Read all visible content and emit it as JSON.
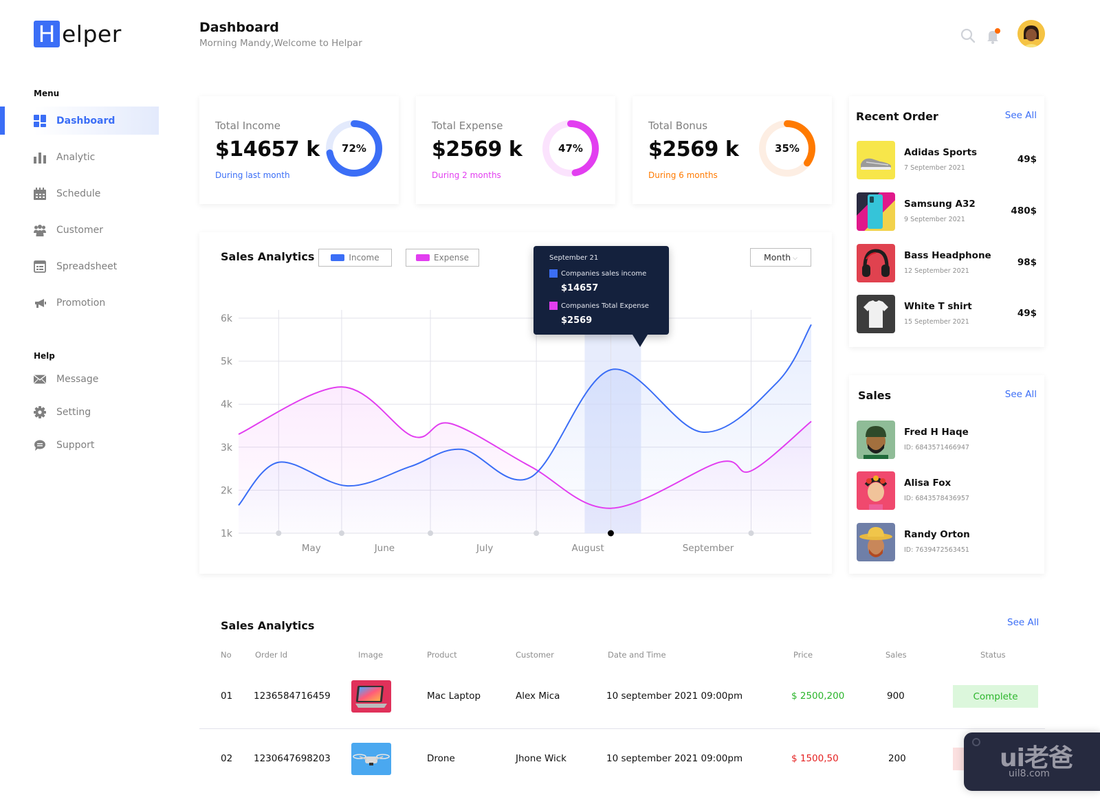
{
  "app": {
    "logo_letter": "H",
    "logo_rest": "elper"
  },
  "header": {
    "title": "Dashboard",
    "subtitle": "Morning Mandy,Welcome to Helpar",
    "icons": [
      "search-icon",
      "bell-icon",
      "user-avatar"
    ],
    "notification_dot_color": "#ff6b00"
  },
  "sidebar": {
    "menu_heading": "Menu",
    "menu_items": [
      {
        "label": "Dashboard",
        "icon": "dashboard-grid-icon",
        "active": true
      },
      {
        "label": "Analytic",
        "icon": "bar-chart-icon",
        "active": false
      },
      {
        "label": "Schedule",
        "icon": "calendar-icon",
        "active": false
      },
      {
        "label": "Customer",
        "icon": "users-icon",
        "active": false
      },
      {
        "label": "Spreadsheet",
        "icon": "spreadsheet-icon",
        "active": false
      },
      {
        "label": "Promotion",
        "icon": "megaphone-icon",
        "active": false
      }
    ],
    "help_heading": "Help",
    "help_items": [
      {
        "label": "Message",
        "icon": "envelope-icon"
      },
      {
        "label": "Setting",
        "icon": "gear-icon"
      },
      {
        "label": "Support",
        "icon": "chat-bubble-icon"
      }
    ]
  },
  "stats": [
    {
      "label": "Total Income",
      "value": "$14657 k",
      "note": "During last month",
      "percent_label": "72%",
      "percent": 72,
      "color": "#3b6ef6",
      "track": "#e3eafc"
    },
    {
      "label": "Total Expense",
      "value": "$2569 k",
      "note": "During 2 months",
      "percent_label": "47%",
      "percent": 47,
      "color": "#e23ef0",
      "track": "#fbe3fd"
    },
    {
      "label": "Total Bonus",
      "value": "$2569 k",
      "note": "During 6 months",
      "percent_label": "35%",
      "percent": 35,
      "color": "#ff7a00",
      "track": "#fdeee3"
    }
  ],
  "sales_chart": {
    "title": "Sales Analytics",
    "legend": [
      {
        "label": "Income",
        "color": "#3b6ef6"
      },
      {
        "label": "Expense",
        "color": "#e23ef0"
      }
    ],
    "period_select": "Month",
    "period_chevron": "⌵",
    "tooltip": {
      "date": "September 21",
      "income_label": "Companies sales income",
      "income_value": "$14657",
      "expense_label": "Companies Total Expense",
      "expense_value": "$2569"
    }
  },
  "chart_data": {
    "type": "area",
    "title": "Sales Analytics",
    "xlabel": "",
    "ylabel": "",
    "y_ticks": [
      "6k",
      "5k",
      "4k",
      "3k",
      "2k",
      "1k"
    ],
    "ylim": [
      1000,
      6000
    ],
    "x_labels": [
      "May",
      "June",
      "July",
      "August",
      "September"
    ],
    "x_range": [
      0,
      10
    ],
    "grid": true,
    "legend_position": "top-left",
    "highlight_x": 6.5,
    "x_markers": [
      0.7,
      1.8,
      3.35,
      5.2,
      6.5,
      8.95
    ],
    "series": [
      {
        "name": "Income",
        "color": "#3b6ef6",
        "points": [
          [
            0,
            1650
          ],
          [
            0.7,
            2650
          ],
          [
            1.9,
            2100
          ],
          [
            3.0,
            2550
          ],
          [
            3.9,
            2950
          ],
          [
            5.1,
            2300
          ],
          [
            6.5,
            4800
          ],
          [
            8.1,
            3350
          ],
          [
            9.4,
            4500
          ],
          [
            10,
            5850
          ]
        ]
      },
      {
        "name": "Expense",
        "color": "#e23ef0",
        "points": [
          [
            0,
            3300
          ],
          [
            1.8,
            4400
          ],
          [
            3.05,
            3250
          ],
          [
            3.7,
            3550
          ],
          [
            5.1,
            2550
          ],
          [
            6.5,
            1580
          ],
          [
            8.4,
            2650
          ],
          [
            8.95,
            2450
          ],
          [
            10,
            3600
          ]
        ]
      }
    ]
  },
  "recent_orders": {
    "title": "Recent Order",
    "see_all": "See All",
    "items": [
      {
        "name": "Adidas Sports",
        "date": "7 September 2021",
        "price": "49$",
        "thumb": "sneaker-image"
      },
      {
        "name": "Samsung A32",
        "date": "9 September 2021",
        "price": "480$",
        "thumb": "phone-image"
      },
      {
        "name": "Bass Headphone",
        "date": "12 September 2021",
        "price": "98$",
        "thumb": "headphone-image"
      },
      {
        "name": "White T shirt",
        "date": "15 September 2021",
        "price": "49$",
        "thumb": "tshirt-image"
      }
    ]
  },
  "sales_people": {
    "title": "Sales",
    "see_all": "See All",
    "items": [
      {
        "name": "Fred H Haqe",
        "id": "ID: 6843571466947",
        "thumb": "avatar-fred"
      },
      {
        "name": "Alisa Fox",
        "id": "ID: 6843578436957",
        "thumb": "avatar-alisa"
      },
      {
        "name": "Randy Orton",
        "id": "ID: 7639472563451",
        "thumb": "avatar-randy"
      }
    ]
  },
  "sales_table": {
    "title": "Sales Analytics",
    "see_all": "See All",
    "columns": [
      "No",
      "Order Id",
      "Image",
      "Product",
      "Customer",
      "Date and Time",
      "Price",
      "Sales",
      "Status"
    ],
    "rows": [
      {
        "no": "01",
        "order_id": "1236584716459",
        "image": "laptop-image",
        "product": "Mac Laptop",
        "customer": "Alex Mica",
        "datetime": "10 september 2021 09:00pm",
        "price": "$ 2500,200",
        "price_color": "#2bb52b",
        "sales": "900",
        "status": "Complete",
        "status_bg": "#dcf7dc",
        "status_color": "#2bb52b"
      },
      {
        "no": "02",
        "order_id": "1230647698203",
        "image": "drone-image",
        "product": "Drone",
        "customer": "Jhone Wick",
        "datetime": "10 september 2021 09:00pm",
        "price": "$ 1500,50",
        "price_color": "#e52222",
        "sales": "200",
        "status": "",
        "status_bg": "#fbe0e0",
        "status_color": "#e52222"
      }
    ]
  },
  "watermark": {
    "main": "ui老爸",
    "sub": "uil8.com"
  }
}
